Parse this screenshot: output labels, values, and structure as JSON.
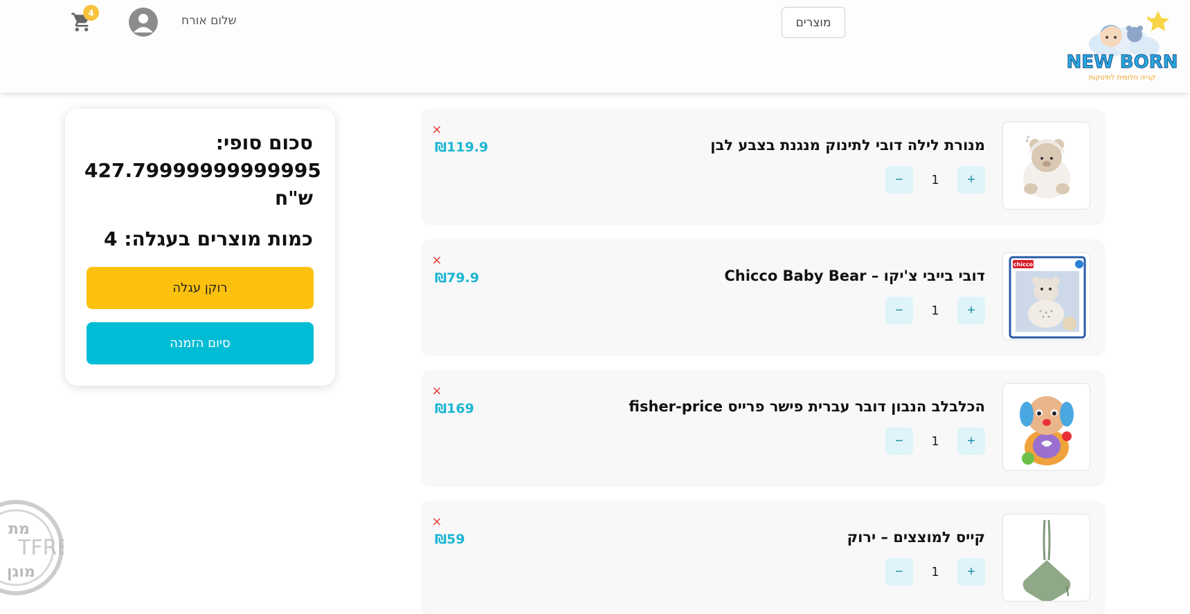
{
  "header": {
    "logo_text": "NEW BORN",
    "logo_tagline": "קנייה חלומית לתינוקות",
    "nav_products_label": "מוצרים",
    "greeting": "שלום אורח",
    "cart_count": "4"
  },
  "cart": {
    "items": [
      {
        "title": "מנורת לילה דובי לתינוק מנגנת בצבע לבן",
        "quantity": "1",
        "price": "₪119.9",
        "plus": "+",
        "minus": "−",
        "remove": "×"
      },
      {
        "title": "דובי בייבי צ'יקו – Chicco Baby Bear",
        "quantity": "1",
        "price": "₪79.9",
        "plus": "+",
        "minus": "−",
        "remove": "×"
      },
      {
        "title": "הכלבלב הנבון דובר עברית פישר פרייס fisher-price",
        "quantity": "1",
        "price": "₪169",
        "plus": "+",
        "minus": "−",
        "remove": "×"
      },
      {
        "title": "קייס למוצצים – ירוק",
        "quantity": "1",
        "price": "₪59",
        "plus": "+",
        "minus": "−",
        "remove": "×"
      }
    ]
  },
  "summary": {
    "total_label": "סכום סופי:",
    "total_value": "427.79999999999995",
    "currency": "ש\"ח",
    "count_label": "כמות מוצרים בעגלה: 4",
    "clear_button": "רוקן עגלה",
    "checkout_button": "סיום הזמנה"
  },
  "watermark": {
    "text_top": "מת",
    "text_mid": "TFREE",
    "text_bottom": "מוגן"
  },
  "colors": {
    "accent": "#00bcd4",
    "price": "#1cb6d3",
    "clear_button": "#fcc10e",
    "remove": "#e53935",
    "badge": "#f9c23c"
  }
}
